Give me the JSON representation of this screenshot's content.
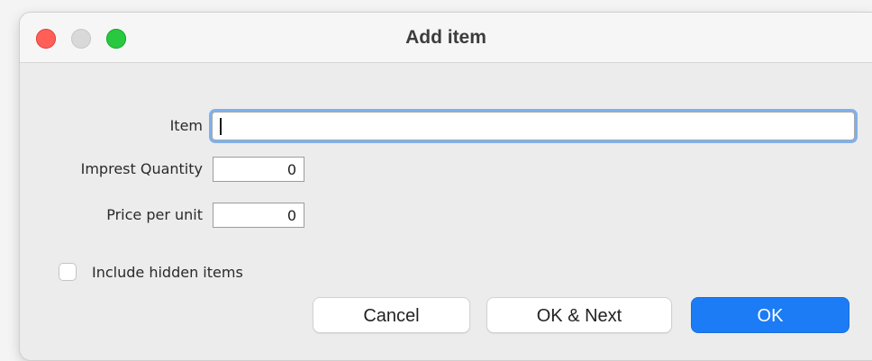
{
  "window": {
    "title": "Add item"
  },
  "form": {
    "item_label": "Item",
    "item_value": "",
    "imprest_quantity_label": "Imprest Quantity",
    "imprest_quantity_value": "0",
    "price_per_unit_label": "Price per unit",
    "price_per_unit_value": "0",
    "include_hidden_label": "Include hidden items",
    "include_hidden_checked": false
  },
  "buttons": {
    "cancel": "Cancel",
    "ok_next": "OK & Next",
    "ok": "OK"
  },
  "colors": {
    "close": "#ff5f57",
    "minimize": "#d9d9d9",
    "maximize": "#28c840",
    "focus_ring": "#7fb0ec",
    "primary": "#1c7cf5"
  }
}
